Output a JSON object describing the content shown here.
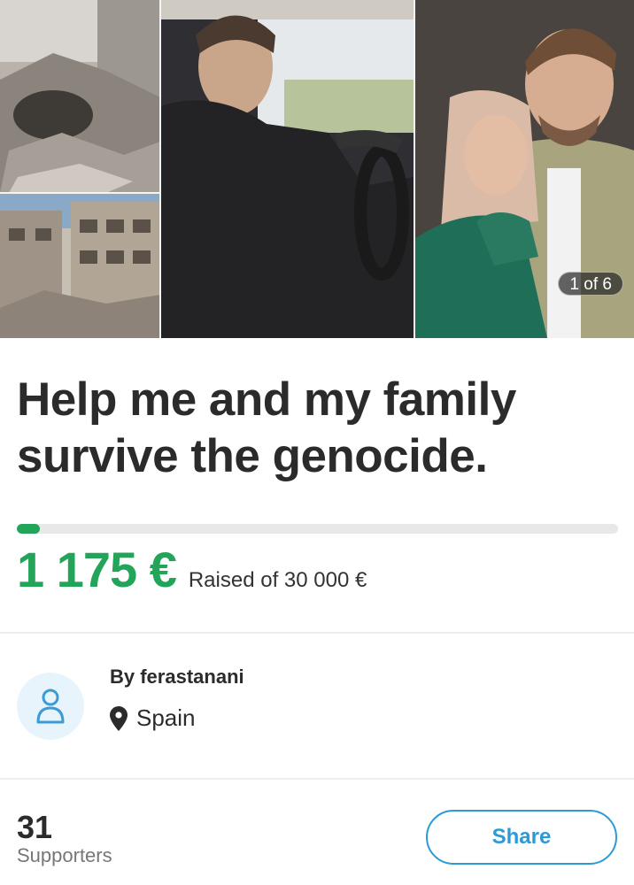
{
  "gallery": {
    "counter_label": "1 of 6"
  },
  "campaign": {
    "title_line1": "Help me and my family",
    "title_line2": "survive the genocide.",
    "raised_amount": "1 175 €",
    "raised_goal_text": "Raised of 30 000 €",
    "progress_fraction": 0.039,
    "accent_color": "#22a459"
  },
  "organizer": {
    "name_text": "By ferastanani",
    "location": "Spain",
    "avatar_icon": "user-icon"
  },
  "footer": {
    "supporters_count": "31",
    "supporters_label": "Supporters",
    "share_label": "Share",
    "share_color": "#2d9ad8"
  }
}
